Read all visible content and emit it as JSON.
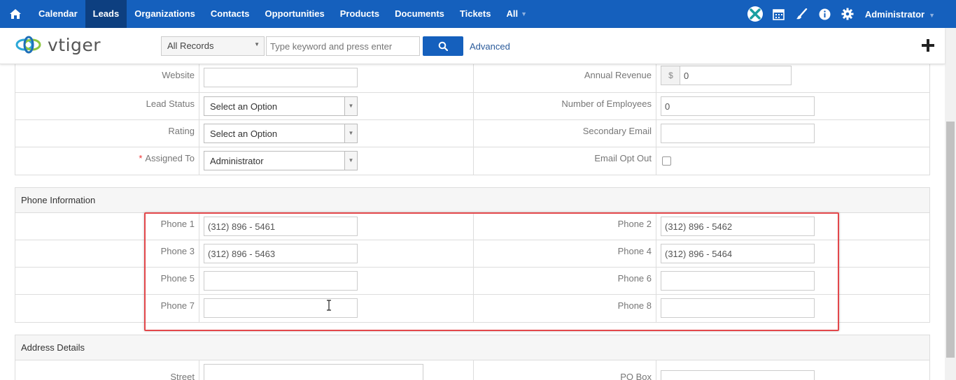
{
  "nav": {
    "items": [
      "Calendar",
      "Leads",
      "Organizations",
      "Contacts",
      "Opportunities",
      "Products",
      "Documents",
      "Tickets",
      "All"
    ],
    "active": "Leads",
    "user": "Administrator"
  },
  "search": {
    "scope": "All Records",
    "placeholder": "Type keyword and press enter",
    "advanced": "Advanced"
  },
  "brand": {
    "logo_text": "vtiger"
  },
  "details": {
    "website_label": "Website",
    "website_value": "",
    "annual_revenue_label": "Annual Revenue",
    "currency_symbol": "$",
    "annual_revenue_value": "0",
    "lead_status_label": "Lead Status",
    "lead_status_value": "Select an Option",
    "employees_label": "Number of Employees",
    "employees_value": "0",
    "rating_label": "Rating",
    "rating_value": "Select an Option",
    "secondary_email_label": "Secondary Email",
    "secondary_email_value": "",
    "assigned_to_label": "Assigned To",
    "assigned_to_value": "Administrator",
    "email_opt_out_label": "Email Opt Out"
  },
  "phone": {
    "header": "Phone Information",
    "phone1_label": "Phone 1",
    "phone1_value": "(312) 896 - 5461",
    "phone2_label": "Phone 2",
    "phone2_value": "(312) 896 - 5462",
    "phone3_label": "Phone 3",
    "phone3_value": "(312) 896 - 5463",
    "phone4_label": "Phone 4",
    "phone4_value": "(312) 896 - 5464",
    "phone5_label": "Phone 5",
    "phone5_value": "",
    "phone6_label": "Phone 6",
    "phone6_value": "",
    "phone7_label": "Phone 7",
    "phone7_value": "",
    "phone8_label": "Phone 8",
    "phone8_value": ""
  },
  "address": {
    "header": "Address Details",
    "street_label": "Street",
    "po_box_label": "PO Box"
  },
  "colors": {
    "nav_bg": "#1560bd",
    "nav_active": "#0d3f80",
    "highlight": "#e3474a"
  }
}
